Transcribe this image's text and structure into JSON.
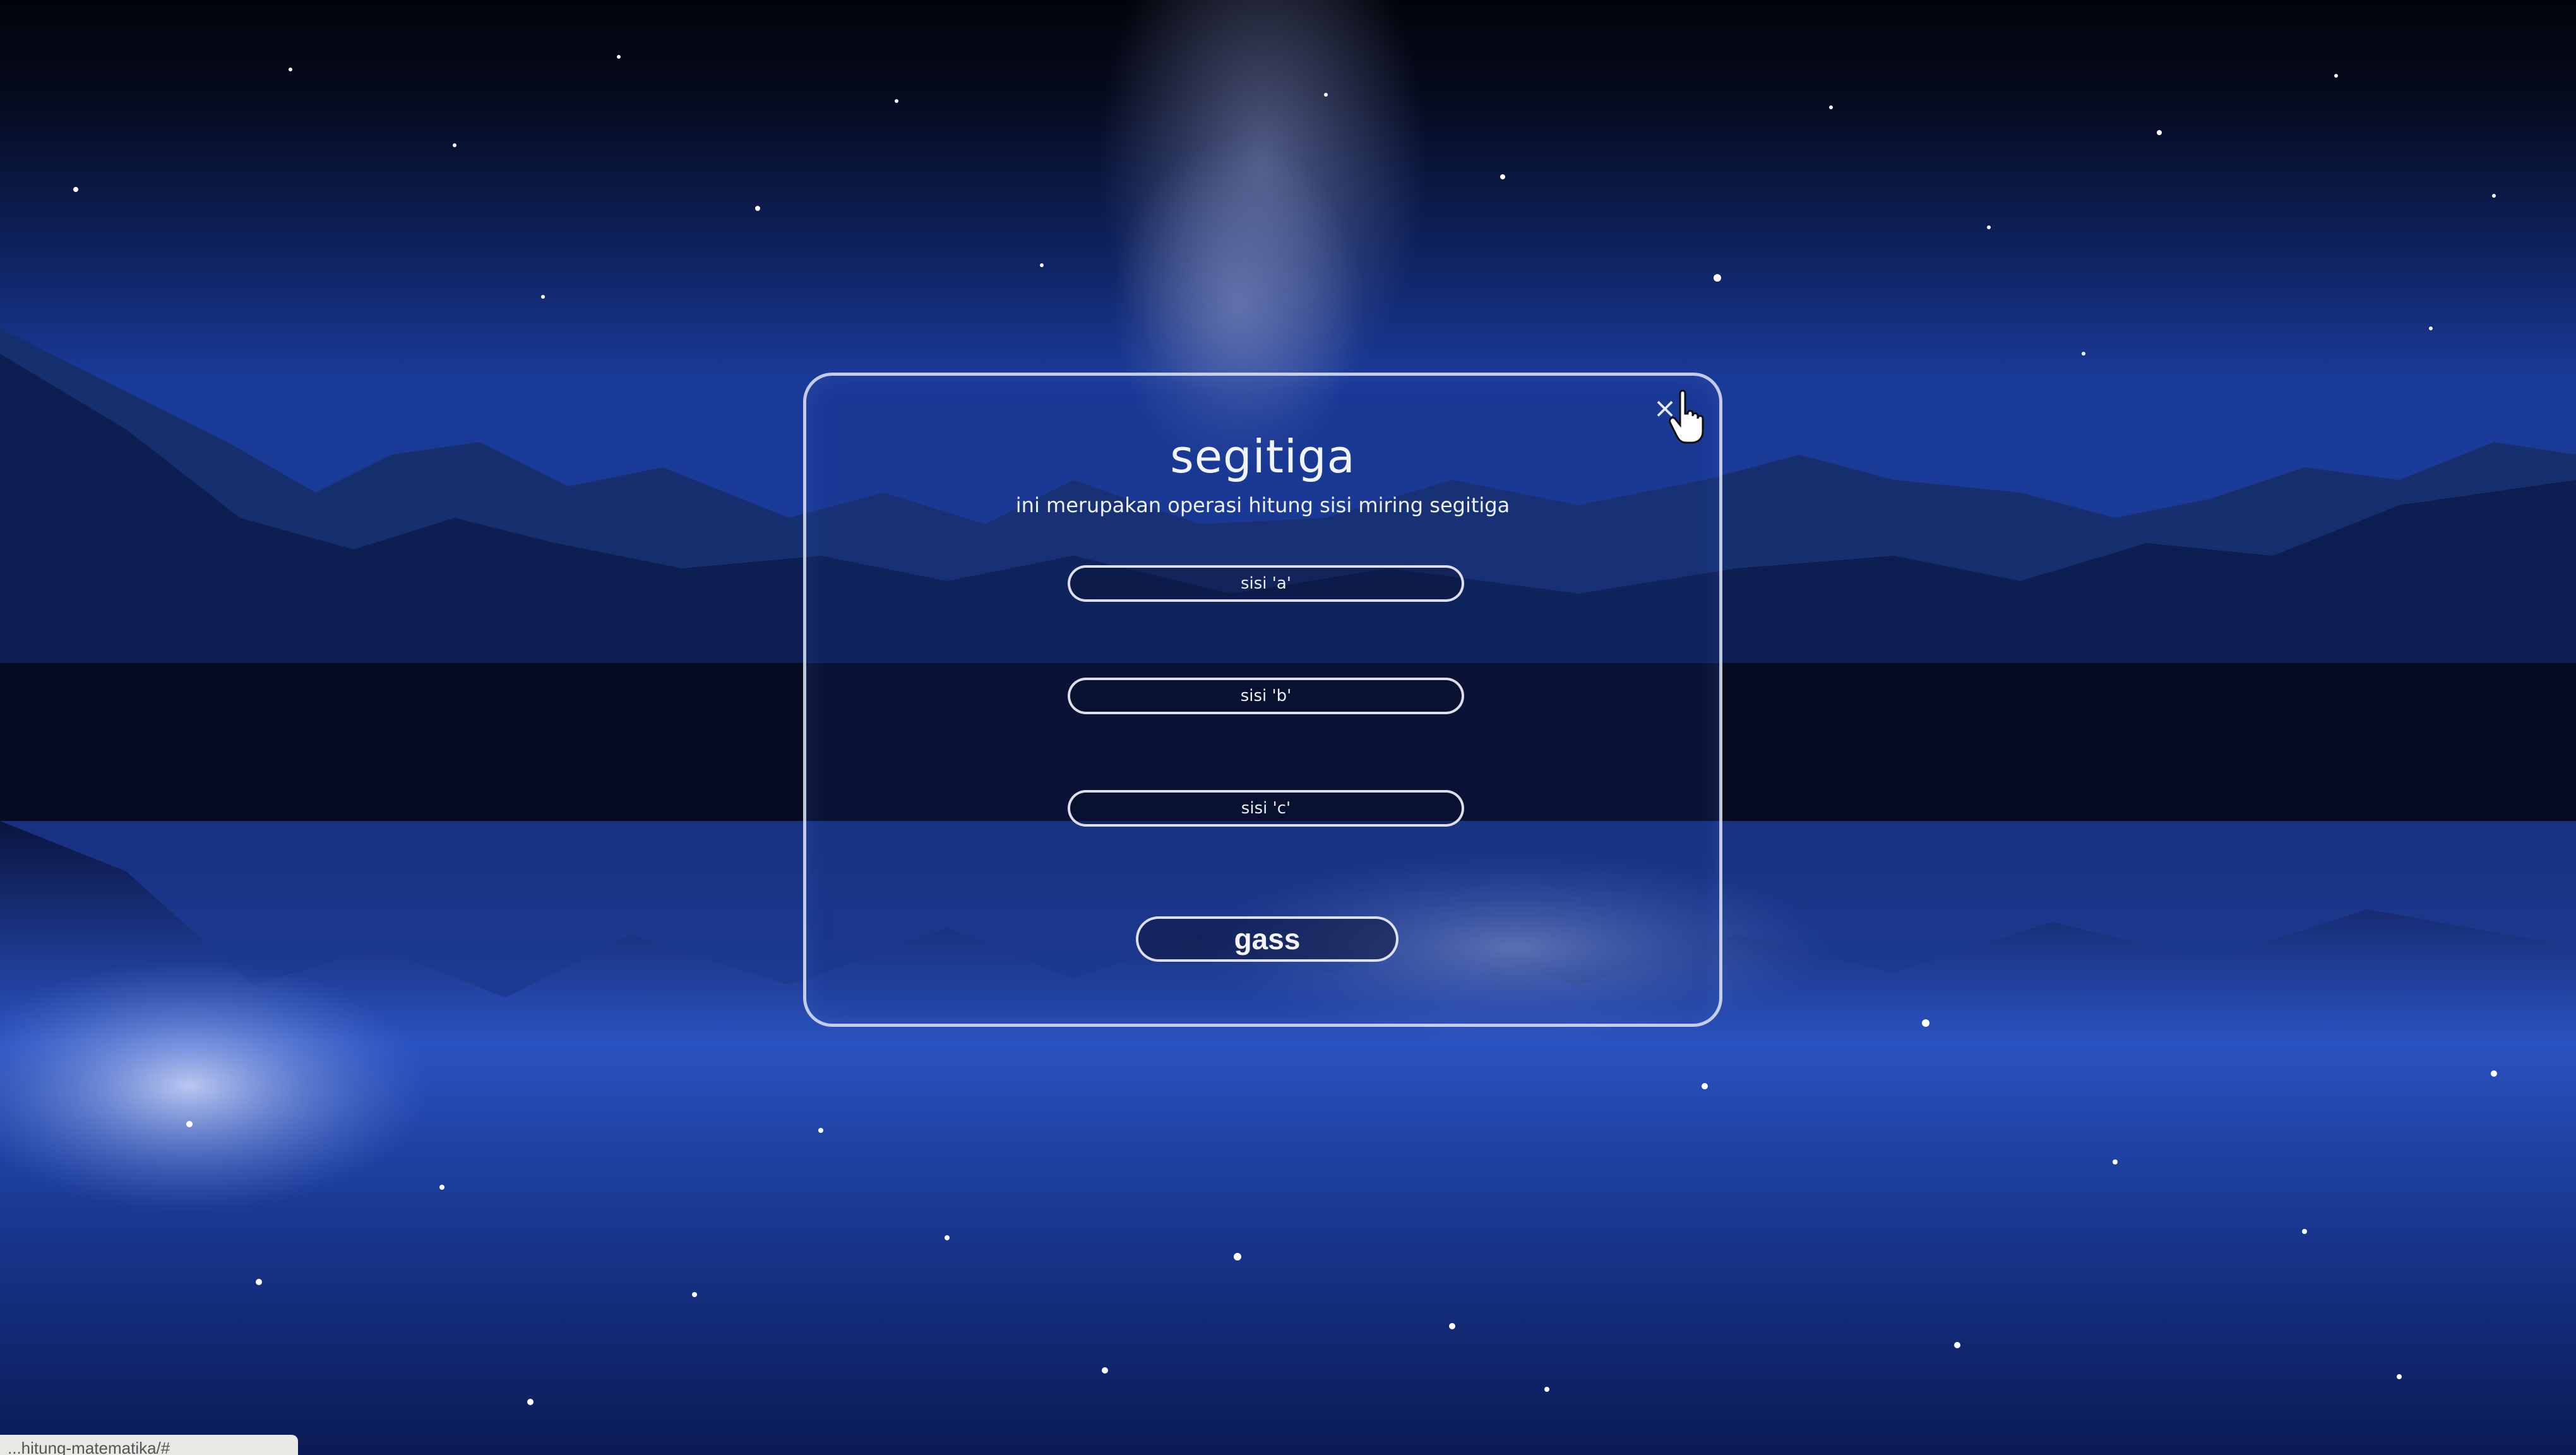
{
  "dialog": {
    "title": "segitiga",
    "subtitle": "ini merupakan operasi hitung sisi miring segitiga",
    "close_symbol": "×",
    "inputs": [
      {
        "placeholder": "sisi 'a'",
        "value": ""
      },
      {
        "placeholder": "sisi 'b'",
        "value": ""
      },
      {
        "placeholder": "sisi 'c'",
        "value": ""
      }
    ],
    "submit_label": "gass"
  },
  "status_bar": {
    "url_text": "...hitung-matematika/#"
  },
  "icons": {
    "close": "close-icon",
    "cursor": "hand-pointer-icon"
  },
  "colors": {
    "modal_border": "#e1e6f5",
    "text": "#f2f4fb",
    "sky_top": "#04060f",
    "sky_mid": "#132a6e",
    "water": "#1a3a9a"
  }
}
